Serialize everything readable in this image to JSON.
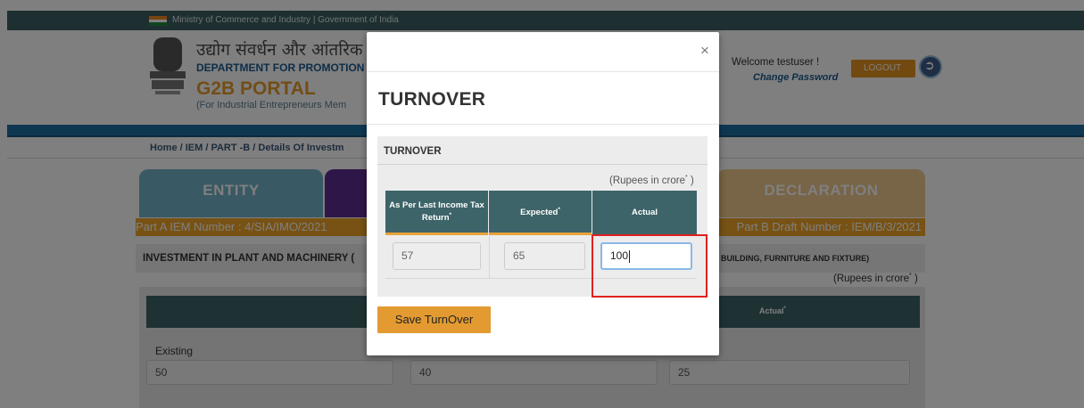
{
  "topbar": {
    "text": "Ministry of Commerce and Industry  |  Government of India"
  },
  "header": {
    "hindi_title": "उद्योग संवर्धन और आंतरिक",
    "department": "DEPARTMENT FOR PROMOTION",
    "portal": "G2B PORTAL",
    "portal_sub": "(For Industrial Entrepreneurs Mem",
    "welcome": "Welcome testuser !",
    "change_password": "Change Password",
    "logout": "LOGOUT"
  },
  "breadcrumb": {
    "text": "Home  /  IEM  /  PART -B  /  Details Of Investm"
  },
  "tabs": [
    {
      "label": "ENTITY"
    },
    {
      "label": ""
    },
    {
      "label": "DECLARATION"
    }
  ],
  "iem": {
    "part_a": "Part A IEM Number :  4/SIA/IMO/2021",
    "part_b": "Part B Draft Number :  IEM/B/3/2021"
  },
  "investment": {
    "heading_left": "INVESTMENT IN PLANT AND MACHINERY (",
    "heading_right": "BUILDING, FURNITURE AND FIXTURE)",
    "rupees": "(Rupees in crore",
    "rupees_sup": "*",
    "rupees_close": " )",
    "actual_header": "Actual",
    "actual_sup": "*",
    "row_label": "Existing",
    "values": [
      "50",
      "40",
      "25"
    ]
  },
  "modal": {
    "title": "TURNOVER",
    "close": "×",
    "section": "TURNOVER",
    "rupees": "(Rupees in crore",
    "rupees_sup": "*",
    "rupees_close": " )",
    "columns": [
      {
        "label": "As Per Last Income Tax Return",
        "sup": "*"
      },
      {
        "label": "Expected",
        "sup": "*"
      },
      {
        "label": "Actual",
        "sup": ""
      }
    ],
    "values": {
      "last_itr": "57",
      "expected": "65",
      "actual": "100"
    },
    "save_label": "Save TurnOver"
  },
  "colors": {
    "topbar": "#3b5e63",
    "header_teal": "#3d6468",
    "accent_orange": "#e39a30",
    "entity_tab": "#73b3c8",
    "purple_tab": "#5e2d91",
    "declaration_tab": "#f1c88d",
    "highlight_red": "#e02020"
  }
}
